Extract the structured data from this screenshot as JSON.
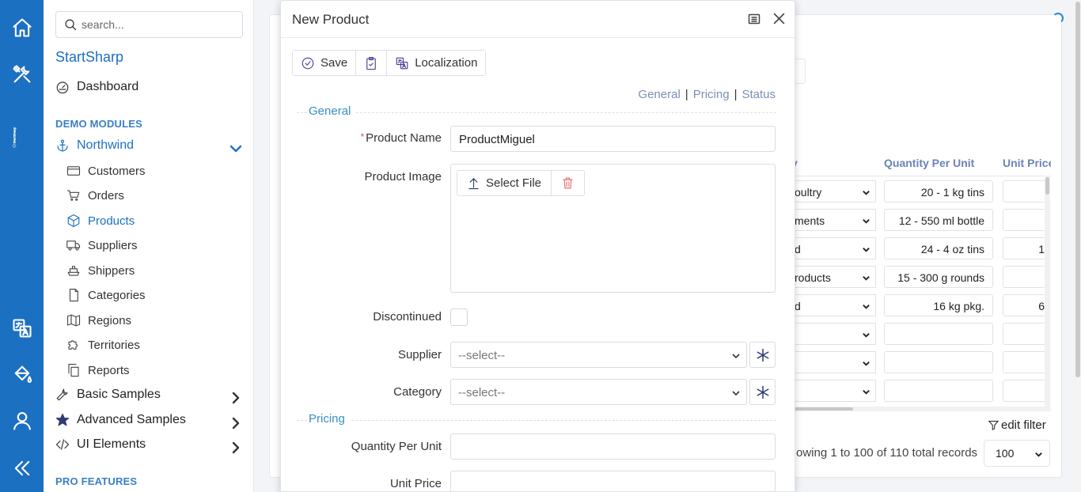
{
  "rail": {
    "icons": [
      "home-icon",
      "tools-icon",
      "localization-icon",
      "paint-bucket-icon",
      "user-icon",
      "collapse-icon"
    ],
    "brand_text": "StartSharp"
  },
  "sidebar": {
    "search_placeholder": "search...",
    "app_title": "StartSharp",
    "dashboard": "Dashboard",
    "demo_modules": "DEMO MODULES",
    "northwind": "Northwind",
    "items": [
      "Customers",
      "Orders",
      "Products",
      "Suppliers",
      "Shippers",
      "Categories",
      "Regions",
      "Territories",
      "Reports"
    ],
    "active_item": "Products",
    "basic_samples": "Basic Samples",
    "advanced_samples": "Advanced Samples",
    "ui_elements": "UI Elements",
    "pro_features": "PRO FEATURES"
  },
  "grid": {
    "columns": [
      "y",
      "Quantity Per Unit",
      "Unit Price"
    ],
    "rows": [
      {
        "category": "oultry",
        "quantity": "20 - 1 kg tins",
        "price": ""
      },
      {
        "category": "ments",
        "quantity": "12 - 550 ml bottle",
        "price": ""
      },
      {
        "category": "d",
        "quantity": "24 - 4 oz tins",
        "price": "1"
      },
      {
        "category": "roducts",
        "quantity": "15 - 300 g rounds",
        "price": ""
      },
      {
        "category": "d",
        "quantity": "16 kg pkg.",
        "price": "6"
      },
      {
        "category": "",
        "quantity": "",
        "price": ""
      },
      {
        "category": "",
        "quantity": "",
        "price": ""
      },
      {
        "category": "",
        "quantity": "",
        "price": ""
      }
    ],
    "edit_filter": "edit filter",
    "paging_text": "owing 1 to 100 of 110 total records",
    "page_size": "100"
  },
  "dialog": {
    "title": "New Product",
    "toolbar": {
      "save": "Save",
      "localization": "Localization"
    },
    "tab_links": {
      "general": "General",
      "separator": "|",
      "pricing": "Pricing",
      "status": "Status"
    },
    "categories": {
      "general": "General",
      "pricing": "Pricing"
    },
    "fields": {
      "required_mark": "*",
      "product_name_label": "Product Name",
      "product_name_value": "ProductMiguel",
      "product_image_label": "Product Image",
      "select_file": "Select File",
      "discontinued_label": "Discontinued",
      "supplier_label": "Supplier",
      "supplier_value": "--select--",
      "category_label": "Category",
      "category_value": "--select--",
      "quantity_label": "Quantity Per Unit",
      "unit_price_label": "Unit Price"
    }
  },
  "colors": {
    "rail": "#1c70c2",
    "accent": "#1c70c2",
    "category_head": "#3a8fc6",
    "tab_link": "#7c8fb3",
    "delete_icon": "#e57373"
  }
}
